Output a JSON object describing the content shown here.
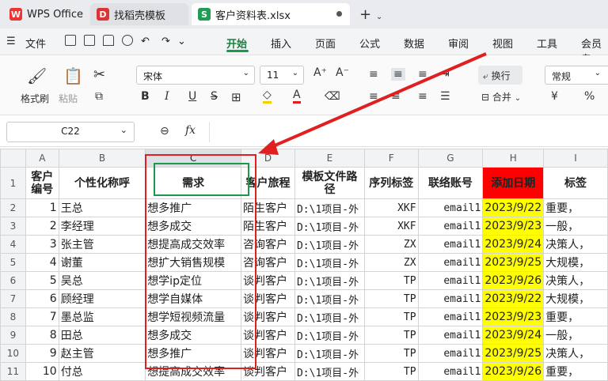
{
  "tabs": {
    "wps": "WPS Office",
    "template": "找稻壳模板",
    "doc": "客户资料表.xlsx"
  },
  "menu": {
    "file": "文件",
    "items": [
      "开始",
      "插入",
      "页面",
      "公式",
      "数据",
      "审阅",
      "视图",
      "工具",
      "会员专"
    ]
  },
  "ribbon": {
    "format_painter": "格式刷",
    "paste": "粘贴",
    "font": "宋体",
    "size": "11",
    "wrap": "换行",
    "merge": "合并",
    "num_format": "常规",
    "bold": "B",
    "italic": "I",
    "underline": "U",
    "currency": "¥",
    "percent": "%"
  },
  "formula": {
    "cell_ref": "C22",
    "fx": "fx"
  },
  "sheet": {
    "col_headers": [
      "A",
      "B",
      "C",
      "D",
      "E",
      "F",
      "G",
      "H",
      "I"
    ],
    "header_row": {
      "row": "1",
      "cells": [
        "客户编号",
        "个性化称呼",
        "需求",
        "客户旅程",
        "模板文件路径",
        "序列标签",
        "联络账号",
        "添加日期",
        "标签"
      ]
    },
    "rows": [
      {
        "row": "2",
        "cells": [
          "1",
          "王总",
          "想多推广",
          "陌生客户",
          "D:\\1项目-外",
          "XKF",
          "email1",
          "2023/9/22",
          "重要，"
        ]
      },
      {
        "row": "3",
        "cells": [
          "2",
          "李经理",
          "想多成交",
          "陌生客户",
          "D:\\1项目-外",
          "XKF",
          "email1",
          "2023/9/23",
          "一般，"
        ]
      },
      {
        "row": "4",
        "cells": [
          "3",
          "张主管",
          "想提高成交效率",
          "咨询客户",
          "D:\\1项目-外",
          "ZX",
          "email1",
          "2023/9/24",
          "决策人，"
        ]
      },
      {
        "row": "5",
        "cells": [
          "4",
          "谢董",
          "想扩大销售规模",
          "咨询客户",
          "D:\\1项目-外",
          "ZX",
          "email1",
          "2023/9/25",
          "大规模，"
        ]
      },
      {
        "row": "6",
        "cells": [
          "5",
          "吴总",
          "想学ip定位",
          "谈判客户",
          "D:\\1项目-外",
          "TP",
          "email1",
          "2023/9/26",
          "决策人，"
        ]
      },
      {
        "row": "7",
        "cells": [
          "6",
          "顾经理",
          "想学自媒体",
          "谈判客户",
          "D:\\1项目-外",
          "TP",
          "email1",
          "2023/9/22",
          "大规模，"
        ]
      },
      {
        "row": "8",
        "cells": [
          "7",
          "墨总监",
          "想学短视频流量",
          "谈判客户",
          "D:\\1项目-外",
          "TP",
          "email1",
          "2023/9/23",
          "重要，"
        ]
      },
      {
        "row": "9",
        "cells": [
          "8",
          "田总",
          "想多成交",
          "谈判客户",
          "D:\\1项目-外",
          "TP",
          "email1",
          "2023/9/24",
          "一般，"
        ]
      },
      {
        "row": "10",
        "cells": [
          "9",
          "赵主管",
          "想多推广",
          "谈判客户",
          "D:\\1项目-外",
          "TP",
          "email1",
          "2023/9/25",
          "决策人，"
        ]
      },
      {
        "row": "11",
        "cells": [
          "10",
          "付总",
          "想提高成交效率",
          "谈判客户",
          "D:\\1项目-外",
          "TP",
          "email1",
          "2023/9/26",
          "重要，"
        ]
      }
    ]
  },
  "colors": {
    "accent": "#1a9a48",
    "date_fill": "#ffff00",
    "header_fill": "#ff0000",
    "annotation": "#e02020"
  }
}
